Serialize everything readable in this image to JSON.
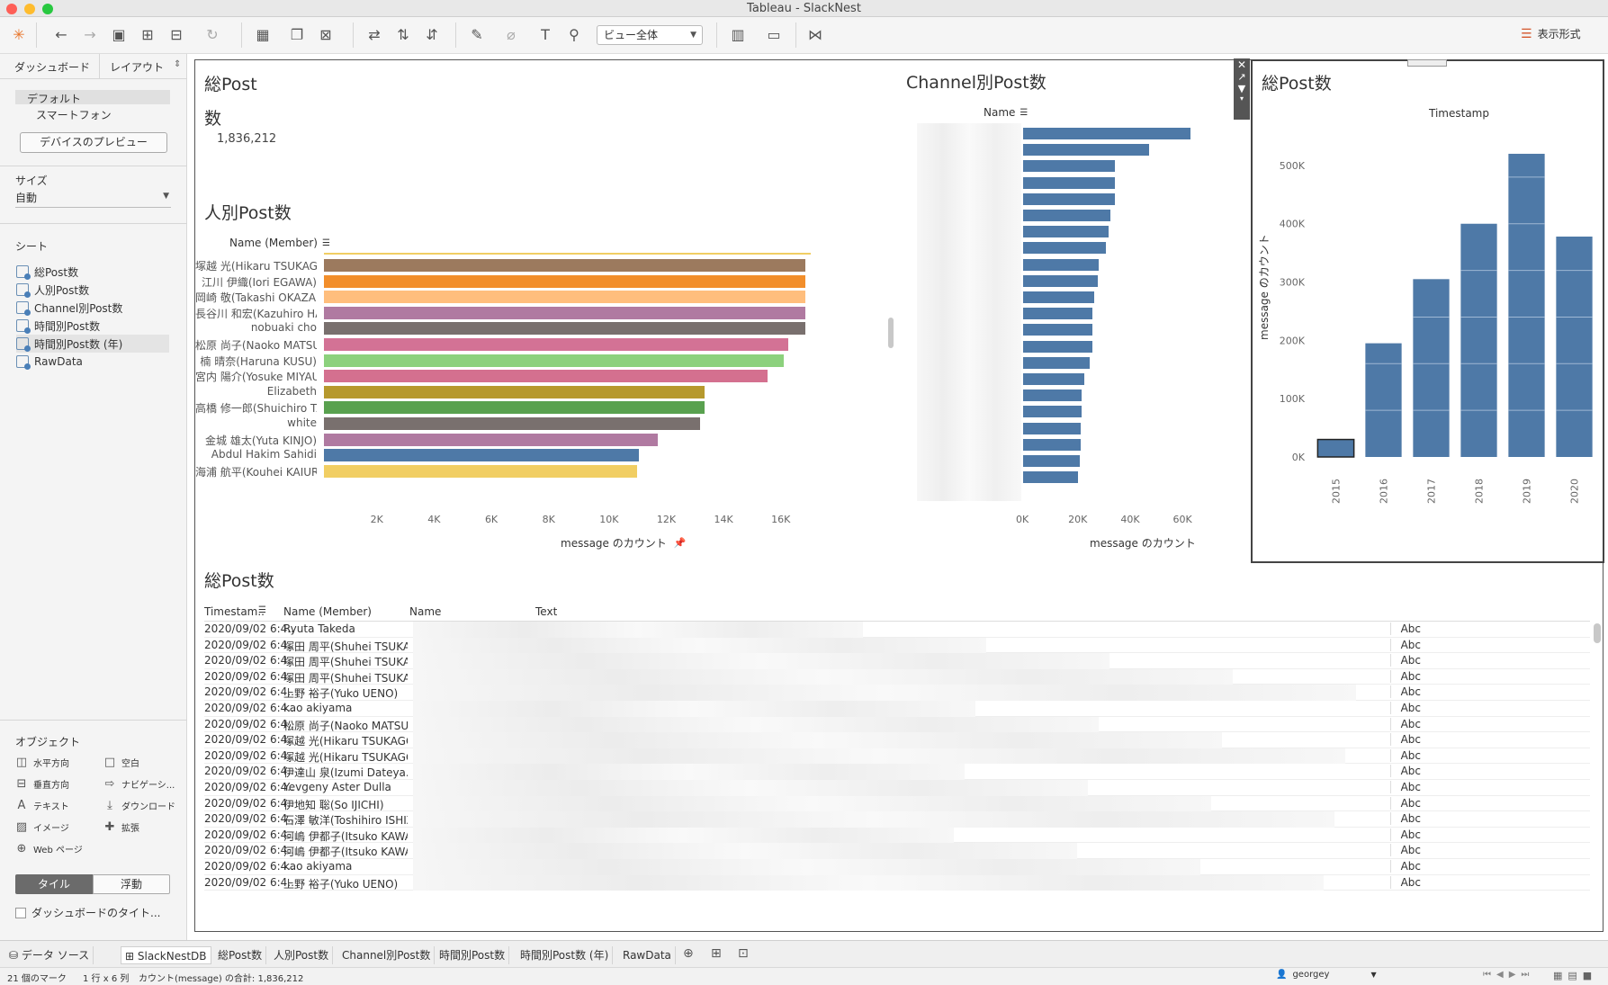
{
  "window": {
    "title": "Tableau - SlackNest"
  },
  "toolbar": {
    "view_select": "ビュー全体",
    "show_me": "表示形式"
  },
  "sidebar": {
    "tabs": [
      "ダッシュボード",
      "レイアウト"
    ],
    "devices": [
      "デフォルト",
      "スマートフォン"
    ],
    "device_preview": "デバイスのプレビュー",
    "size_label": "サイズ",
    "size_value": "自動",
    "sheets_label": "シート",
    "sheets": [
      "総Post数",
      "人別Post数",
      "Channel別Post数",
      "時間別Post数",
      "時間別Post数 (年)",
      "RawData"
    ],
    "objects_label": "オブジェクト",
    "objects": [
      {
        "icon": "horizontal-icon",
        "label": "水平方向"
      },
      {
        "icon": "blank-icon",
        "label": "空白"
      },
      {
        "icon": "vertical-icon",
        "label": "垂直方向"
      },
      {
        "icon": "navigation-icon",
        "label": "ナビゲーシ..."
      },
      {
        "icon": "text-icon",
        "label": "テキスト"
      },
      {
        "icon": "download-icon",
        "label": "ダウンロード"
      },
      {
        "icon": "image-icon",
        "label": "イメージ"
      },
      {
        "icon": "extension-icon",
        "label": "拡張"
      },
      {
        "icon": "web-icon",
        "label": "Web ページ"
      }
    ],
    "tile": "タイル",
    "float": "浮動",
    "dashboard_title": "ダッシュボードのタイト..."
  },
  "kpi": {
    "title_line1": "総Post",
    "title_line2": "数",
    "value": "1,836,212"
  },
  "person_chart": {
    "title": "人別Post数",
    "header": "Name (Member)",
    "xlabel": "message のカウント"
  },
  "channel_chart": {
    "title": "Channel別Post数",
    "header": "Name",
    "xlabel": "message のカウント"
  },
  "year_chart": {
    "title": "総Post数",
    "header": "Timestamp",
    "ylabel": "message のカウント"
  },
  "table": {
    "title": "総Post数",
    "headers": [
      "Timestam..",
      "Name (Member)",
      "Name",
      "Text"
    ],
    "abc": "Abc",
    "rows": [
      {
        "ts": "2020/09/02 6:4..",
        "member": "Ryuta Takeda"
      },
      {
        "ts": "2020/09/02 6:4..",
        "member": "塚田 周平(Shuhei TSUKADA)"
      },
      {
        "ts": "2020/09/02 6:4..",
        "member": "塚田 周平(Shuhei TSUKADA)"
      },
      {
        "ts": "2020/09/02 6:4..",
        "member": "塚田 周平(Shuhei TSUKADA)"
      },
      {
        "ts": "2020/09/02 6:4..",
        "member": "上野 裕子(Yuko UENO)"
      },
      {
        "ts": "2020/09/02 6:4..",
        "member": "kao akiyama"
      },
      {
        "ts": "2020/09/02 6:4..",
        "member": "松原 尚子(Naoko MATSUB.."
      },
      {
        "ts": "2020/09/02 6:4..",
        "member": "塚越 光(Hikaru TSUKAGOS.."
      },
      {
        "ts": "2020/09/02 6:4..",
        "member": "塚越 光(Hikaru TSUKAGOS.."
      },
      {
        "ts": "2020/09/02 6:4..",
        "member": "伊達山 泉(Izumi Dateya.."
      },
      {
        "ts": "2020/09/02 6:4..",
        "member": "Yevgeny Aster Dulla"
      },
      {
        "ts": "2020/09/02 6:4..",
        "member": "伊地知 聡(So IJICHI)"
      },
      {
        "ts": "2020/09/02 6:4..",
        "member": "石澤 敏洋(Toshihiro ISHIZ.."
      },
      {
        "ts": "2020/09/02 6:4..",
        "member": "河嶋 伊都子(Itsuko KAWAS.."
      },
      {
        "ts": "2020/09/02 6:4..",
        "member": "河嶋 伊都子(Itsuko KAWAS.."
      },
      {
        "ts": "2020/09/02 6:4..",
        "member": "kao akiyama"
      },
      {
        "ts": "2020/09/02 6:4..",
        "member": "上野 裕子(Yuko UENO)"
      }
    ]
  },
  "sheet_tabs": [
    "データ ソース",
    "SlackNestDB",
    "総Post数",
    "人別Post数",
    "Channel別Post数",
    "時間別Post数",
    "時間別Post数 (年)",
    "RawData"
  ],
  "status": {
    "marks": "21 個のマーク",
    "dims": "1 行 x 6 列",
    "sum": "カウント(message) の合計: 1,836,212",
    "user": "georgey"
  },
  "chart_data": [
    {
      "type": "bar",
      "orientation": "horizontal",
      "title": "人別Post数",
      "ylabel": "Name (Member)",
      "xlabel": "message のカウント",
      "categories": [
        "塚越 光(Hikaru TSUKAGOS..",
        "江川 伊織(Iori EGAWA)",
        "岡崎 敬(Takashi OKAZAKI)",
        "長谷川 和宏(Kazuhiro HAS..",
        "nobuaki cho",
        "松原 尚子(Naoko MATSUB..",
        "楠 晴奈(Haruna KUSU)",
        "宮内 陽介(Yosuke MIYAUC..",
        "Elizabeth",
        "高橋 修一郎(Shuichiro TAK..",
        "white",
        "金城 雄太(Yuta KINJO)",
        "Abdul Hakim Sahidi",
        "海浦 航平(Kouhei KAIURA)"
      ],
      "values": [
        16800,
        16800,
        16800,
        16800,
        16800,
        16200,
        16050,
        15500,
        13300,
        13300,
        13150,
        11650,
        11000,
        10950
      ],
      "colors": [
        "#9c7a5e",
        "#f28e2b",
        "#ffbe7d",
        "#b07aa1",
        "#79706e",
        "#d37295",
        "#8cd17d",
        "#d4708f",
        "#b6992d",
        "#59a14f",
        "#79706e",
        "#b07aa1",
        "#4e79a7",
        "#f1ce63"
      ],
      "xticks": [
        2000,
        4000,
        6000,
        8000,
        10000,
        12000,
        14000,
        16000
      ],
      "xtick_labels": [
        "2K",
        "4K",
        "6K",
        "8K",
        "10K",
        "12K",
        "14K",
        "16K"
      ],
      "xlim": [
        0,
        17000
      ]
    },
    {
      "type": "bar",
      "orientation": "horizontal",
      "title": "Channel別Post数",
      "ylabel": "Name",
      "xlabel": "message のカウント",
      "values": [
        64000,
        48000,
        35000,
        35000,
        35000,
        33500,
        32500,
        31500,
        29000,
        28500,
        27000,
        26500,
        26500,
        26500,
        25500,
        23500,
        22500,
        22500,
        22000,
        22000,
        21500,
        21000
      ],
      "xticks": [
        0,
        20000,
        40000,
        60000
      ],
      "xtick_labels": [
        "0K",
        "20K",
        "40K",
        "60K"
      ],
      "xlim": [
        0,
        66000
      ]
    },
    {
      "type": "bar",
      "orientation": "vertical",
      "title": "総Post数",
      "xlabel": "Timestamp",
      "ylabel": "message のカウント",
      "categories": [
        "2015",
        "2016",
        "2017",
        "2018",
        "2019",
        "2020"
      ],
      "values": [
        30000,
        195000,
        305000,
        400000,
        520000,
        378000
      ],
      "yticks": [
        0,
        100000,
        200000,
        300000,
        400000,
        500000
      ],
      "ytick_labels": [
        "0K",
        "100K",
        "200K",
        "300K",
        "400K",
        "500K"
      ],
      "ylim": [
        0,
        540000
      ]
    }
  ]
}
